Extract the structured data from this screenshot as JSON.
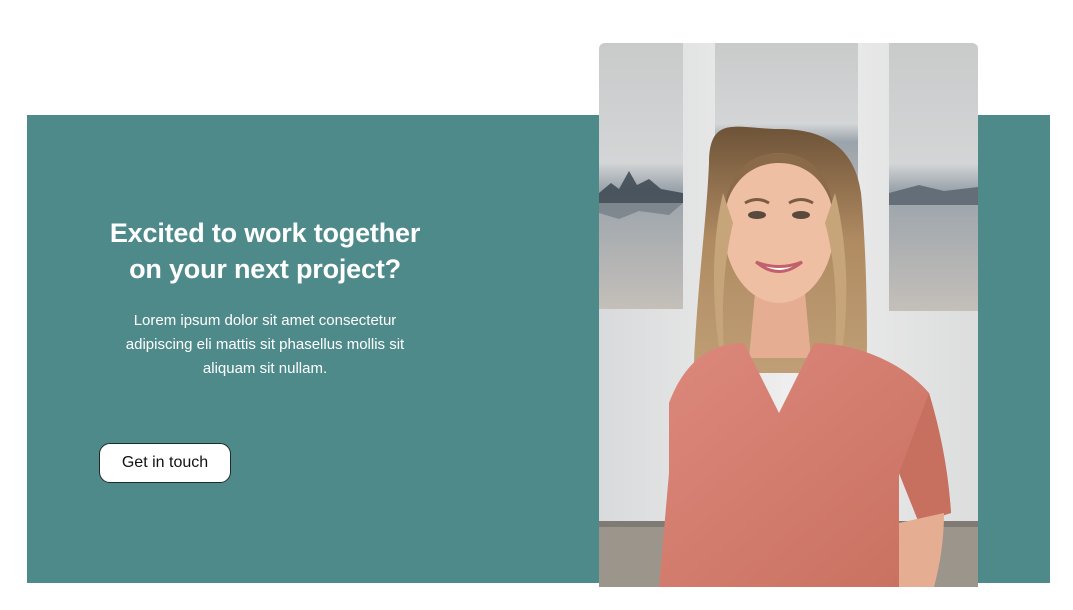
{
  "cta": {
    "title": "Excited to work together on your next project?",
    "text": "Lorem ipsum dolor sit amet consectetur adipiscing eli mattis sit phasellus mollis sit aliquam sit nullam.",
    "button_label": "Get in touch"
  },
  "colors": {
    "band": "#4f8a8b",
    "heading": "#ffffff",
    "button_bg": "#ffffff",
    "button_border": "#1e2b2b",
    "blouse": "#d77f74",
    "hair": "#b08b62",
    "wall": "#e5e6e6"
  }
}
